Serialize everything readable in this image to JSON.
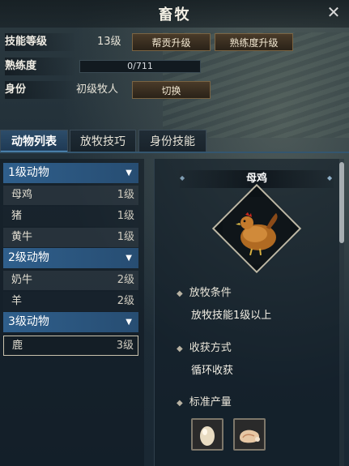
{
  "window": {
    "title": "畜牧",
    "close_glyph": "✕"
  },
  "info": {
    "skill_level_label": "技能等级",
    "skill_level_value": "13级",
    "guild_upgrade_button": "帮贡升级",
    "proficiency_upgrade_button": "熟练度升级",
    "proficiency_label": "熟练度",
    "proficiency_value": "0/711",
    "proficiency_fraction": 0,
    "identity_label": "身份",
    "identity_value": "初级牧人",
    "switch_button": "切换"
  },
  "tabs": [
    {
      "label": "动物列表",
      "active": true
    },
    {
      "label": "放牧技巧",
      "active": false
    },
    {
      "label": "身份技能",
      "active": false
    }
  ],
  "animal_list": {
    "groups": [
      {
        "label": "1级动物",
        "items": [
          {
            "name": "母鸡",
            "level": "1级"
          },
          {
            "name": "猪",
            "level": "1级"
          },
          {
            "name": "黄牛",
            "level": "1级"
          }
        ]
      },
      {
        "label": "2级动物",
        "items": [
          {
            "name": "奶牛",
            "level": "2级"
          },
          {
            "name": "羊",
            "level": "2级"
          }
        ]
      },
      {
        "label": "3级动物",
        "items": [
          {
            "name": "鹿",
            "level": "3级"
          }
        ]
      }
    ]
  },
  "detail": {
    "name": "母鸡",
    "condition_title": "放牧条件",
    "condition_text": "放牧技能1级以上",
    "harvest_title": "收获方式",
    "harvest_text": "循环收获",
    "output_title": "标准产量",
    "output_icons": [
      "egg-icon",
      "meat-icon"
    ]
  },
  "colors": {
    "accent": "#2f5f8c",
    "tab_active": "#2d4d6a",
    "button_border": "#7a6443"
  }
}
